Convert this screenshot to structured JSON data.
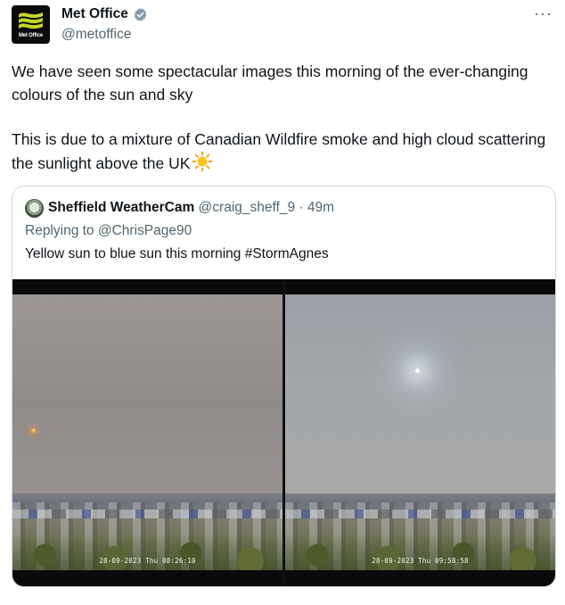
{
  "author": {
    "name": "Met Office",
    "handle": "@metoffice",
    "logo_text": "Met Office",
    "verified": true,
    "verified_color": "#829aab"
  },
  "tweet": {
    "paragraph1": "We have seen some spectacular images this morning of the ever-changing colours of the sun and sky",
    "paragraph2": "This is due to a mixture of Canadian Wildfire smoke and high cloud scattering the sunlight above the UK",
    "emoji": "sun-emoji"
  },
  "quote": {
    "name": "Sheffield WeatherCam",
    "handle": "@craig_sheff_9",
    "separator": "·",
    "time": "49m",
    "replying_prefix": "Replying to ",
    "replying_to": "@ChrisPage90",
    "text": "Yellow sun to blue sun this morning #StormAgnes",
    "photos": [
      {
        "timestamp": "28-09-2023 Thu 08:26:10"
      },
      {
        "timestamp": "28-09-2023 Thu 09:58:58"
      }
    ]
  },
  "icons": {
    "more": "more-icon",
    "verified": "verified-badge-icon"
  }
}
